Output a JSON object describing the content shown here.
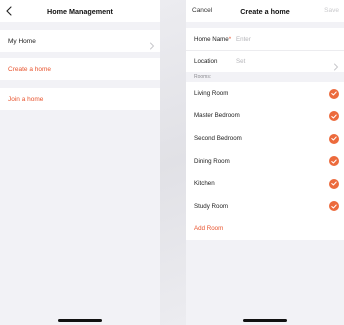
{
  "left_screen": {
    "title": "Home Management",
    "back_icon": "chevron-left-icon",
    "home_item": {
      "label": "My Home"
    },
    "create_home": {
      "label": "Create a home"
    },
    "join_home": {
      "label": "Join a home"
    }
  },
  "right_screen": {
    "title": "Create a home",
    "cancel_label": "Cancel",
    "save_label": "Save",
    "home_name": {
      "label": "Home Name",
      "required_mark": "*",
      "placeholder": "Enter"
    },
    "location": {
      "label": "Location",
      "value": "Set"
    },
    "rooms_header": "Rooms:",
    "rooms": [
      {
        "label": "Living Room",
        "checked": true
      },
      {
        "label": "Master Bedroom",
        "checked": true
      },
      {
        "label": "Second Bedroom",
        "checked": true
      },
      {
        "label": "Dining Room",
        "checked": true
      },
      {
        "label": "Kitchen",
        "checked": true
      },
      {
        "label": "Study Room",
        "checked": true
      }
    ],
    "add_room_label": "Add Room"
  },
  "colors": {
    "accent": "#e8542e",
    "check_fill": "#ec6a3c",
    "background": "#f2f2f6",
    "disabled_text": "#c9c9cc"
  }
}
